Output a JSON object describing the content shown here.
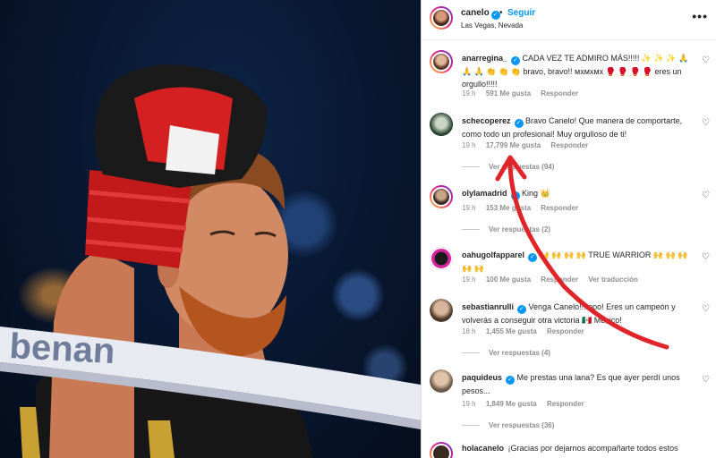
{
  "post": {
    "username": "canelo",
    "follow_label": "Seguir",
    "separator": "•",
    "location": "Las Vegas, Nevada",
    "photo_text": "benan"
  },
  "comments": [
    {
      "username": "anarregina_",
      "verified": true,
      "text": "CADA VEZ TE ADMIRO MÁS!!!!! ✨ ✨ ✨ 🙏 🙏 🙏 👏 👏 👏 bravo, bravo!! мхмхмх 🥊 🥊 🥊 🥊 eres un orgullo!!!!!",
      "time": "19 h",
      "likes": "591 Me gusta",
      "reply": "Responder"
    },
    {
      "username": "schecoperez",
      "verified": true,
      "text": "Bravo Canelo! Que manera de comportarte, como todo un profesional! Muy orgulloso de ti!",
      "time": "19 h",
      "likes": "17,799 Me gusta",
      "reply": "Responder",
      "view_replies": "Ver respuestas (94)"
    },
    {
      "username": "olylamadrid",
      "verified": true,
      "text": "King 👑",
      "time": "19 h",
      "likes": "153 Me gusta",
      "reply": "Responder",
      "view_replies": "Ver respuestas (2)"
    },
    {
      "username": "oahugolfapparel",
      "verified": true,
      "text": "🙌 🙌 🙌 🙌 TRUE WARRIOR 🙌 🙌 🙌 🙌 🙌",
      "time": "19 h",
      "likes": "100 Me gusta",
      "reply": "Responder",
      "translate": "Ver traducción"
    },
    {
      "username": "sebastianrulli",
      "verified": true,
      "text": "Venga Canelo!!!!ooo! Eres un campeón y volverás a conseguir otra victoria 🇲🇽 México!",
      "time": "18 h",
      "likes": "1,455 Me gusta",
      "reply": "Responder",
      "view_replies": "Ver respuestas (4)"
    },
    {
      "username": "paquideus",
      "verified": true,
      "text": "Me prestas una lana? Es que ayer perdí unos pesos...",
      "time": "19 h",
      "likes": "1,849 Me gusta",
      "reply": "Responder",
      "view_replies": "Ver respuestas (36)"
    },
    {
      "username": "holacanelo",
      "verified": false,
      "text": "¡Gracias por dejarnos acompañarte todos estos",
      "time": "",
      "likes": "",
      "reply": ""
    }
  ],
  "icons": {
    "heart": "♡",
    "more": "•••",
    "verified": "✓"
  },
  "colors": {
    "accent": "#0095f6",
    "annotation_arrow": "#e0252a",
    "muted_text": "#8e8e8e"
  }
}
